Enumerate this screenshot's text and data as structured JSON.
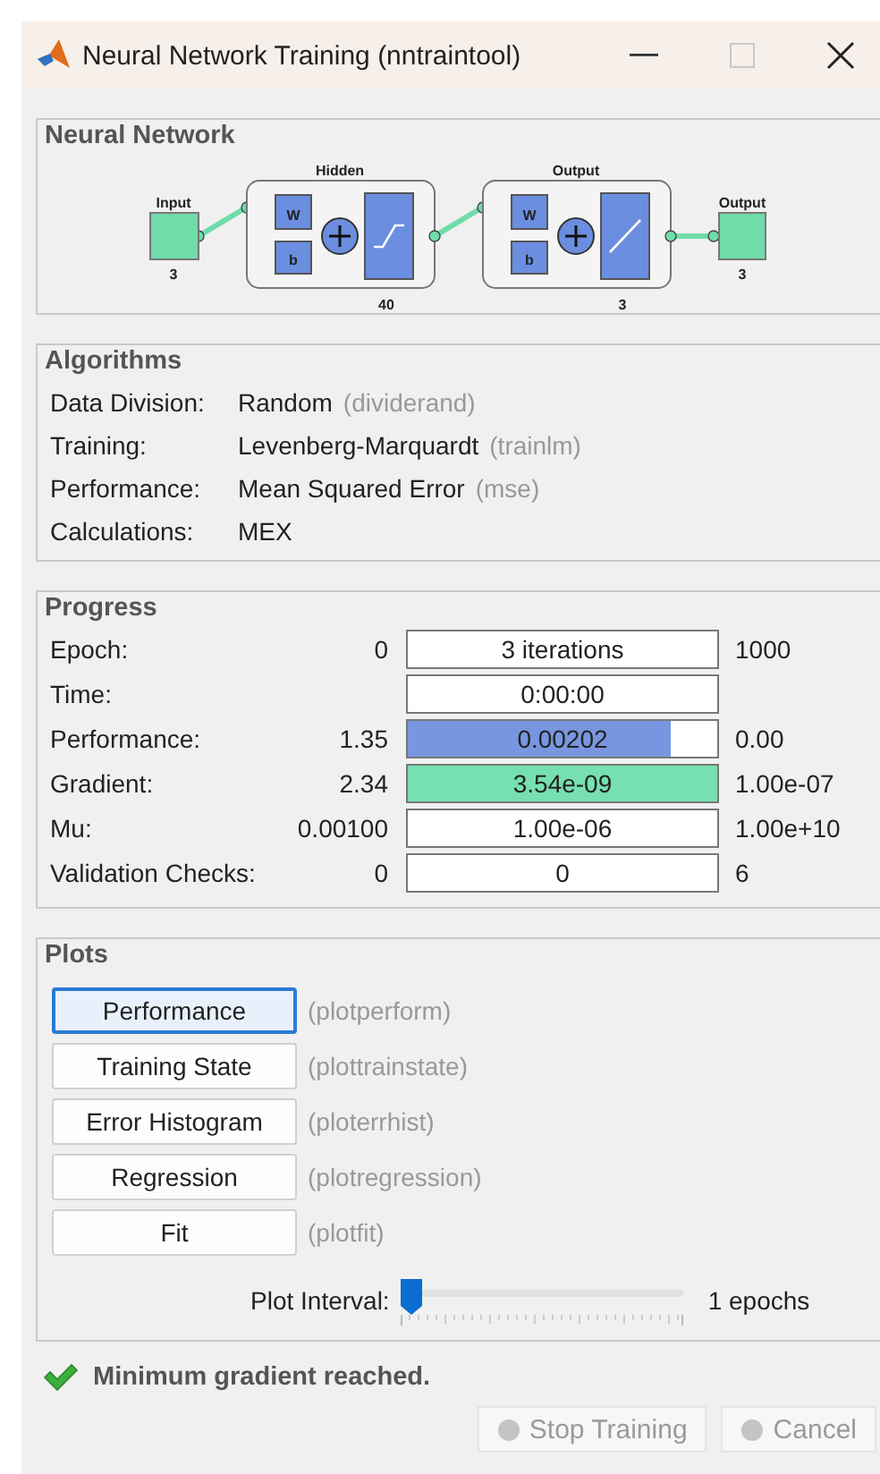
{
  "window": {
    "title": "Neural Network Training (nntraintool)",
    "maximize_disabled": true
  },
  "network": {
    "title": "Neural Network",
    "input": {
      "label": "Input",
      "size": "3"
    },
    "layers": [
      {
        "label": "Hidden",
        "size": "40",
        "weight": "W",
        "bias": "b",
        "kind": "sigmoid"
      },
      {
        "label": "Output",
        "size": "3",
        "weight": "W",
        "bias": "b",
        "kind": "linear"
      }
    ],
    "output": {
      "label": "Output",
      "size": "3"
    }
  },
  "algorithms": {
    "title": "Algorithms",
    "rows": [
      {
        "label": "Data Division:",
        "value": "Random",
        "function": "(dividerand)"
      },
      {
        "label": "Training:",
        "value": "Levenberg-Marquardt",
        "function": "(trainlm)"
      },
      {
        "label": "Performance:",
        "value": "Mean Squared Error",
        "function": "(mse)"
      },
      {
        "label": "Calculations:",
        "value": "MEX"
      }
    ]
  },
  "progress": {
    "title": "Progress",
    "rows": [
      {
        "label": "Epoch:",
        "start": "0",
        "value": "3 iterations",
        "end": "1000"
      },
      {
        "label": "Time:",
        "value": "0:00:00"
      },
      {
        "label": "Performance:",
        "start": "1.35",
        "value": "0.00202",
        "end": "0.00",
        "level": 0.85,
        "color": "#7896e0"
      },
      {
        "label": "Gradient:",
        "start": "2.34",
        "value": "3.54e-09",
        "end": "1.00e-07",
        "level": 1,
        "color": "#76e0b0"
      },
      {
        "label": "Mu:",
        "start": "0.00100",
        "value": "1.00e-06",
        "end": "1.00e+10"
      },
      {
        "label": "Validation Checks:",
        "start": "0",
        "value": "0",
        "end": "6"
      }
    ]
  },
  "plots": {
    "title": "Plots",
    "buttons": [
      {
        "label": "Performance",
        "function": "(plotperform)",
        "selected": true
      },
      {
        "label": "Training State",
        "function": "(plottrainstate)",
        "selected": false
      },
      {
        "label": "Error Histogram",
        "function": "(ploterrhist)",
        "selected": false
      },
      {
        "label": "Regression",
        "function": "(plotregression)",
        "selected": false
      },
      {
        "label": "Fit",
        "function": "(plotfit)",
        "selected": false
      }
    ],
    "interval": {
      "label": "Plot Interval:",
      "level": 0,
      "reading": "1 epochs"
    }
  },
  "status": {
    "message": "Minimum gradient reached."
  },
  "buttons": [
    {
      "label": "Stop Training",
      "disabled": true
    },
    {
      "label": "Cancel",
      "disabled": true
    }
  ]
}
